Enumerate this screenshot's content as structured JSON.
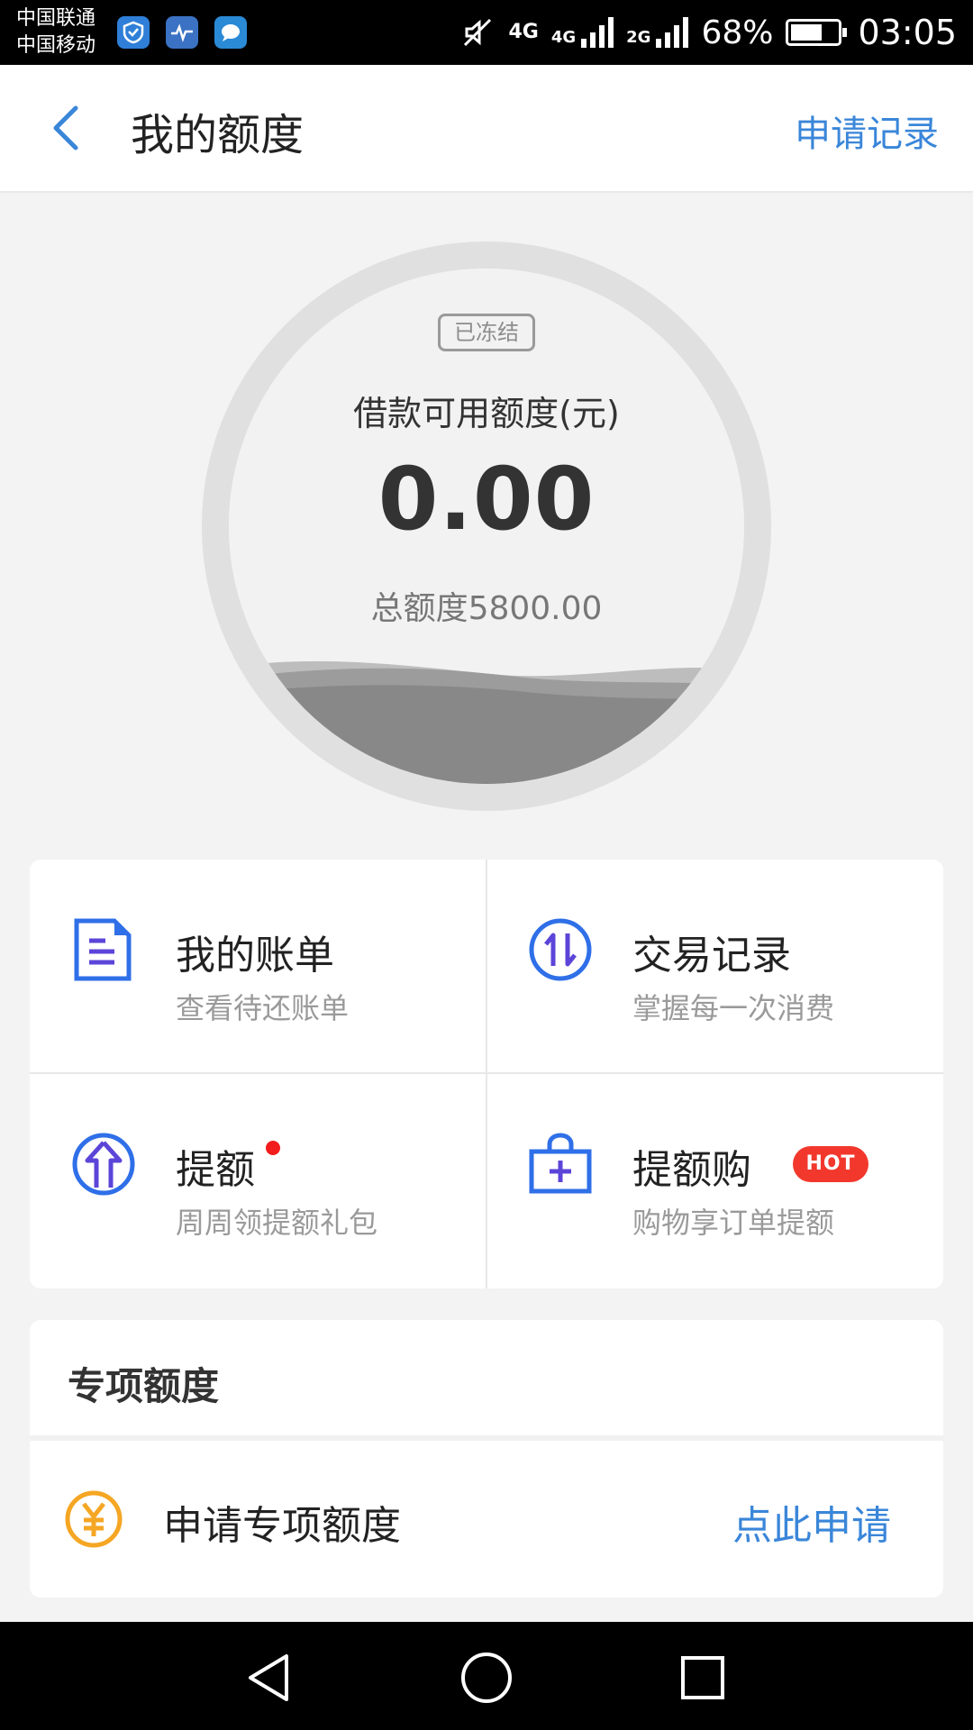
{
  "status_bar": {
    "carrier_1": "中国联通",
    "carrier_2": "中国移动",
    "network_1": "4G",
    "network_2": "4G",
    "network_3": "2G",
    "battery": "68%",
    "time": "03:05",
    "app_icons": [
      "shield-icon",
      "heart-rate-icon",
      "chat-icon"
    ]
  },
  "header": {
    "title": "我的额度",
    "action": "申请记录"
  },
  "gauge": {
    "status_badge": "已冻结",
    "label": "借款可用额度(元)",
    "value": "0.00",
    "total": "总额度5800.00"
  },
  "grid": [
    {
      "title": "我的账单",
      "subtitle": "查看待还账单",
      "icon": "document-icon"
    },
    {
      "title": "交易记录",
      "subtitle": "掌握每一次消费",
      "icon": "exchange-icon"
    },
    {
      "title": "提额",
      "subtitle": "周周领提额礼包",
      "icon": "arrow-up-icon",
      "dot": true
    },
    {
      "title": "提额购",
      "subtitle": "购物享订单提额",
      "icon": "shopping-bag-icon",
      "badge": "HOT"
    }
  ],
  "special": {
    "title": "专项额度",
    "row_label": "申请专项额度",
    "row_action": "点此申请"
  },
  "colors": {
    "accent": "#3a86d9",
    "icon_blue": "#2f6fe8",
    "icon_purple": "#5b45d9",
    "hot_red": "#f2382d",
    "yuan_orange": "#f5a623"
  }
}
